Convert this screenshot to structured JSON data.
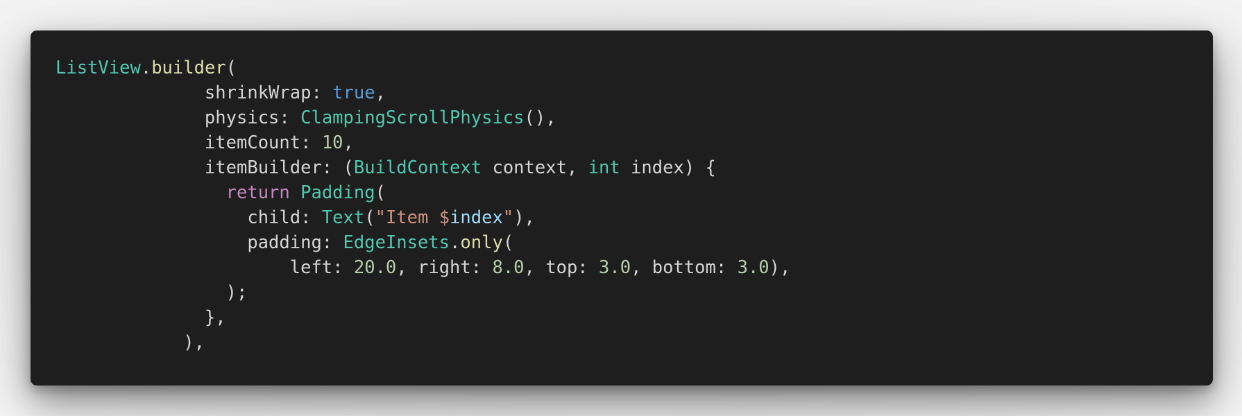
{
  "colors": {
    "card_background": "#1e1e1e",
    "default_text": "#d4d4d4",
    "type": "#4ec9b0",
    "function": "#dcdcaa",
    "keyword_literal": "#569cd6",
    "control_keyword": "#c586c0",
    "number": "#b5cea8",
    "string": "#ce9178",
    "variable": "#9cdcfe"
  },
  "code": {
    "language": "dart",
    "lines": [
      [
        {
          "text": "ListView",
          "kind": "type"
        },
        {
          "text": ".",
          "kind": "default"
        },
        {
          "text": "builder",
          "kind": "function"
        },
        {
          "text": "(",
          "kind": "default"
        }
      ],
      [
        {
          "text": "              shrinkWrap: ",
          "kind": "default"
        },
        {
          "text": "true",
          "kind": "keyword_literal"
        },
        {
          "text": ",",
          "kind": "default"
        }
      ],
      [
        {
          "text": "              physics: ",
          "kind": "default"
        },
        {
          "text": "ClampingScrollPhysics",
          "kind": "type"
        },
        {
          "text": "(),",
          "kind": "default"
        }
      ],
      [
        {
          "text": "              itemCount: ",
          "kind": "default"
        },
        {
          "text": "10",
          "kind": "number"
        },
        {
          "text": ",",
          "kind": "default"
        }
      ],
      [
        {
          "text": "              itemBuilder: (",
          "kind": "default"
        },
        {
          "text": "BuildContext",
          "kind": "type"
        },
        {
          "text": " context, ",
          "kind": "default"
        },
        {
          "text": "int",
          "kind": "type"
        },
        {
          "text": " index) {",
          "kind": "default"
        }
      ],
      [
        {
          "text": "                ",
          "kind": "default"
        },
        {
          "text": "return",
          "kind": "control_keyword"
        },
        {
          "text": " ",
          "kind": "default"
        },
        {
          "text": "Padding",
          "kind": "type"
        },
        {
          "text": "(",
          "kind": "default"
        }
      ],
      [
        {
          "text": "                  child: ",
          "kind": "default"
        },
        {
          "text": "Text",
          "kind": "type"
        },
        {
          "text": "(",
          "kind": "default"
        },
        {
          "text": "\"Item $",
          "kind": "string"
        },
        {
          "text": "index",
          "kind": "variable"
        },
        {
          "text": "\"",
          "kind": "string"
        },
        {
          "text": "),",
          "kind": "default"
        }
      ],
      [
        {
          "text": "                  padding: ",
          "kind": "default"
        },
        {
          "text": "EdgeInsets",
          "kind": "type"
        },
        {
          "text": ".",
          "kind": "default"
        },
        {
          "text": "only",
          "kind": "function"
        },
        {
          "text": "(",
          "kind": "default"
        }
      ],
      [
        {
          "text": "                      left: ",
          "kind": "default"
        },
        {
          "text": "20.0",
          "kind": "number"
        },
        {
          "text": ", right: ",
          "kind": "default"
        },
        {
          "text": "8.0",
          "kind": "number"
        },
        {
          "text": ", top: ",
          "kind": "default"
        },
        {
          "text": "3.0",
          "kind": "number"
        },
        {
          "text": ", bottom: ",
          "kind": "default"
        },
        {
          "text": "3.0",
          "kind": "number"
        },
        {
          "text": "),",
          "kind": "default"
        }
      ],
      [
        {
          "text": "                );",
          "kind": "default"
        }
      ],
      [
        {
          "text": "              },",
          "kind": "default"
        }
      ],
      [
        {
          "text": "            ),",
          "kind": "default"
        }
      ]
    ]
  }
}
